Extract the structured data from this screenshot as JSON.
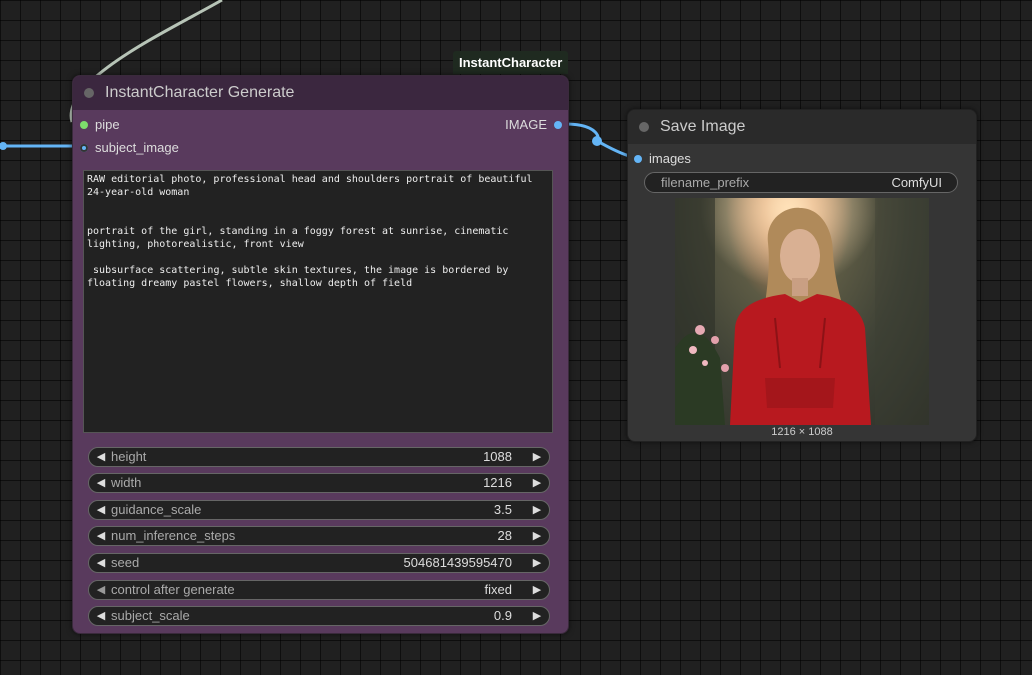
{
  "group": {
    "label": "InstantCharacter"
  },
  "instant_character_node": {
    "title": "InstantCharacter Generate",
    "inputs": [
      {
        "name": "pipe",
        "color": "#7ddc6c"
      },
      {
        "name": "subject_image",
        "color": "#64b5f6"
      }
    ],
    "output": {
      "name": "IMAGE",
      "color": "#64b5f6"
    },
    "prompt": "RAW editorial photo, professional head and shoulders portrait of beautiful\n24-year-old woman\n\n\nportrait of the girl, standing in a foggy forest at sunrise, cinematic\nlighting, photorealistic, front view\n\n subsurface scattering, subtle skin textures, the image is bordered by\nfloating dreamy pastel flowers, shallow depth of field",
    "widgets": [
      {
        "label": "height",
        "value": "1088"
      },
      {
        "label": "width",
        "value": "1216"
      },
      {
        "label": "guidance_scale",
        "value": "3.5"
      },
      {
        "label": "num_inference_steps",
        "value": "28"
      },
      {
        "label": "seed",
        "value": "504681439595470"
      },
      {
        "label": "control after generate",
        "value": "fixed"
      },
      {
        "label": "subject_scale",
        "value": "0.9"
      }
    ]
  },
  "save_image_node": {
    "title": "Save Image",
    "input": {
      "name": "images",
      "color": "#64b5f6"
    },
    "filename_prefix": {
      "label": "filename_prefix",
      "value": "ComfyUI"
    },
    "preview_size": "1216 × 1088"
  },
  "colors": {
    "wire_image": "#64b5f6",
    "wire_pipe": "#b7c4b7"
  }
}
